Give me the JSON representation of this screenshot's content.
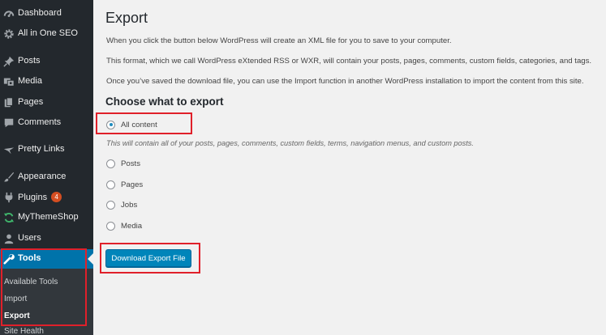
{
  "sidebar": {
    "items": [
      {
        "label": "Dashboard",
        "icon": "dashboard-icon"
      },
      {
        "label": "All in One SEO",
        "icon": "gear-icon"
      },
      {
        "label": "Posts",
        "icon": "pushpin-icon"
      },
      {
        "label": "Media",
        "icon": "media-icon"
      },
      {
        "label": "Pages",
        "icon": "pages-icon"
      },
      {
        "label": "Comments",
        "icon": "comment-icon"
      },
      {
        "label": "Pretty Links",
        "icon": "star-icon"
      },
      {
        "label": "Appearance",
        "icon": "paintbrush-icon"
      },
      {
        "label": "Plugins",
        "icon": "plug-icon",
        "badge": "4"
      },
      {
        "label": "MyThemeShop",
        "icon": "refresh-icon"
      },
      {
        "label": "Users",
        "icon": "user-icon"
      },
      {
        "label": "Tools",
        "icon": "wrench-icon"
      }
    ],
    "submenu": [
      "Available Tools",
      "Import",
      "Export",
      "Site Health"
    ]
  },
  "main": {
    "title": "Export",
    "intro": [
      "When you click the button below WordPress will create an XML file for you to save to your computer.",
      "This format, which we call WordPress eXtended RSS or WXR, will contain your posts, pages, comments, custom fields, categories, and tags.",
      "Once you’ve saved the download file, you can use the Import function in another WordPress installation to import the content from this site."
    ],
    "section_title": "Choose what to export",
    "options": [
      {
        "label": "All content",
        "checked": true
      },
      {
        "label": "Posts",
        "checked": false
      },
      {
        "label": "Pages",
        "checked": false
      },
      {
        "label": "Jobs",
        "checked": false
      },
      {
        "label": "Media",
        "checked": false
      }
    ],
    "all_content_desc": "This will contain all of your posts, pages, comments, custom fields, terms, navigation menus, and custom posts.",
    "download_button": "Download Export File"
  },
  "colors": {
    "sidebar_bg": "#23282d",
    "active_blue": "#0073aa",
    "button_blue": "#0085ba",
    "highlight_red": "#e0202a",
    "badge_orange": "#d54e21"
  }
}
